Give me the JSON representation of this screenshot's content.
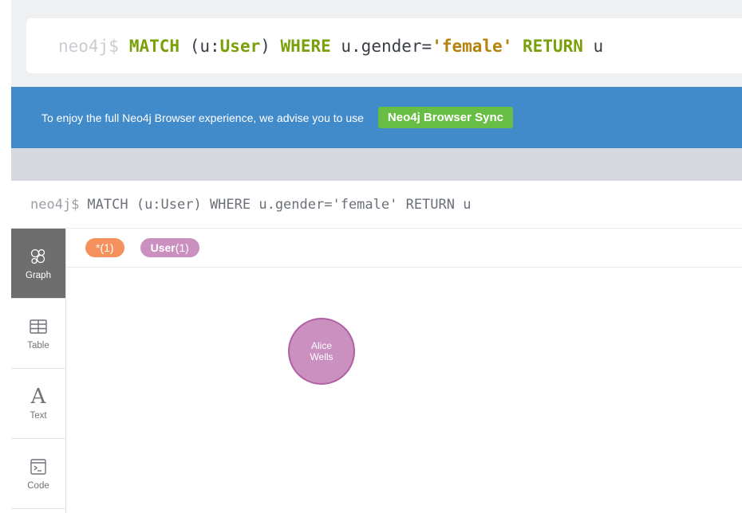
{
  "editor": {
    "prompt": "neo4j$",
    "tokens": [
      {
        "text": "MATCH",
        "kind": "kw"
      },
      {
        "text": " (u:",
        "kind": "plain"
      },
      {
        "text": "User",
        "kind": "kw"
      },
      {
        "text": ") ",
        "kind": "plain"
      },
      {
        "text": "WHERE",
        "kind": "kw"
      },
      {
        "text": " u.gender=",
        "kind": "plain"
      },
      {
        "text": "'female'",
        "kind": "str"
      },
      {
        "text": " ",
        "kind": "plain"
      },
      {
        "text": "RETURN",
        "kind": "kw"
      },
      {
        "text": " u",
        "kind": "plain"
      }
    ]
  },
  "banner": {
    "text": "To enjoy the full Neo4j Browser experience, we advise you to use",
    "button_label": "Neo4j Browser Sync"
  },
  "frame": {
    "prompt": "neo4j$",
    "query": "MATCH (u:User) WHERE u.gender='female' RETURN u",
    "sidebar": {
      "items": [
        {
          "label": "Graph",
          "icon": "graph-icon",
          "active": true
        },
        {
          "label": "Table",
          "icon": "table-icon",
          "active": false
        },
        {
          "label": "Text",
          "icon": "text-icon",
          "glyph": "A",
          "active": false
        },
        {
          "label": "Code",
          "icon": "code-icon",
          "active": false
        }
      ]
    },
    "pills": {
      "all": {
        "label": "*",
        "count": "(1)"
      },
      "user": {
        "label": "User",
        "count": "(1)"
      }
    },
    "node": {
      "line1": "Alice",
      "line2": "Wells"
    }
  },
  "colors": {
    "keyword": "#7aa10a",
    "string": "#b3830e",
    "banner": "#428bca",
    "sync_button": "#68bd45",
    "pill_all": "#f4915c",
    "pill_user": "#c990c0",
    "node_fill": "#c990c0",
    "node_border": "#b261a5"
  }
}
